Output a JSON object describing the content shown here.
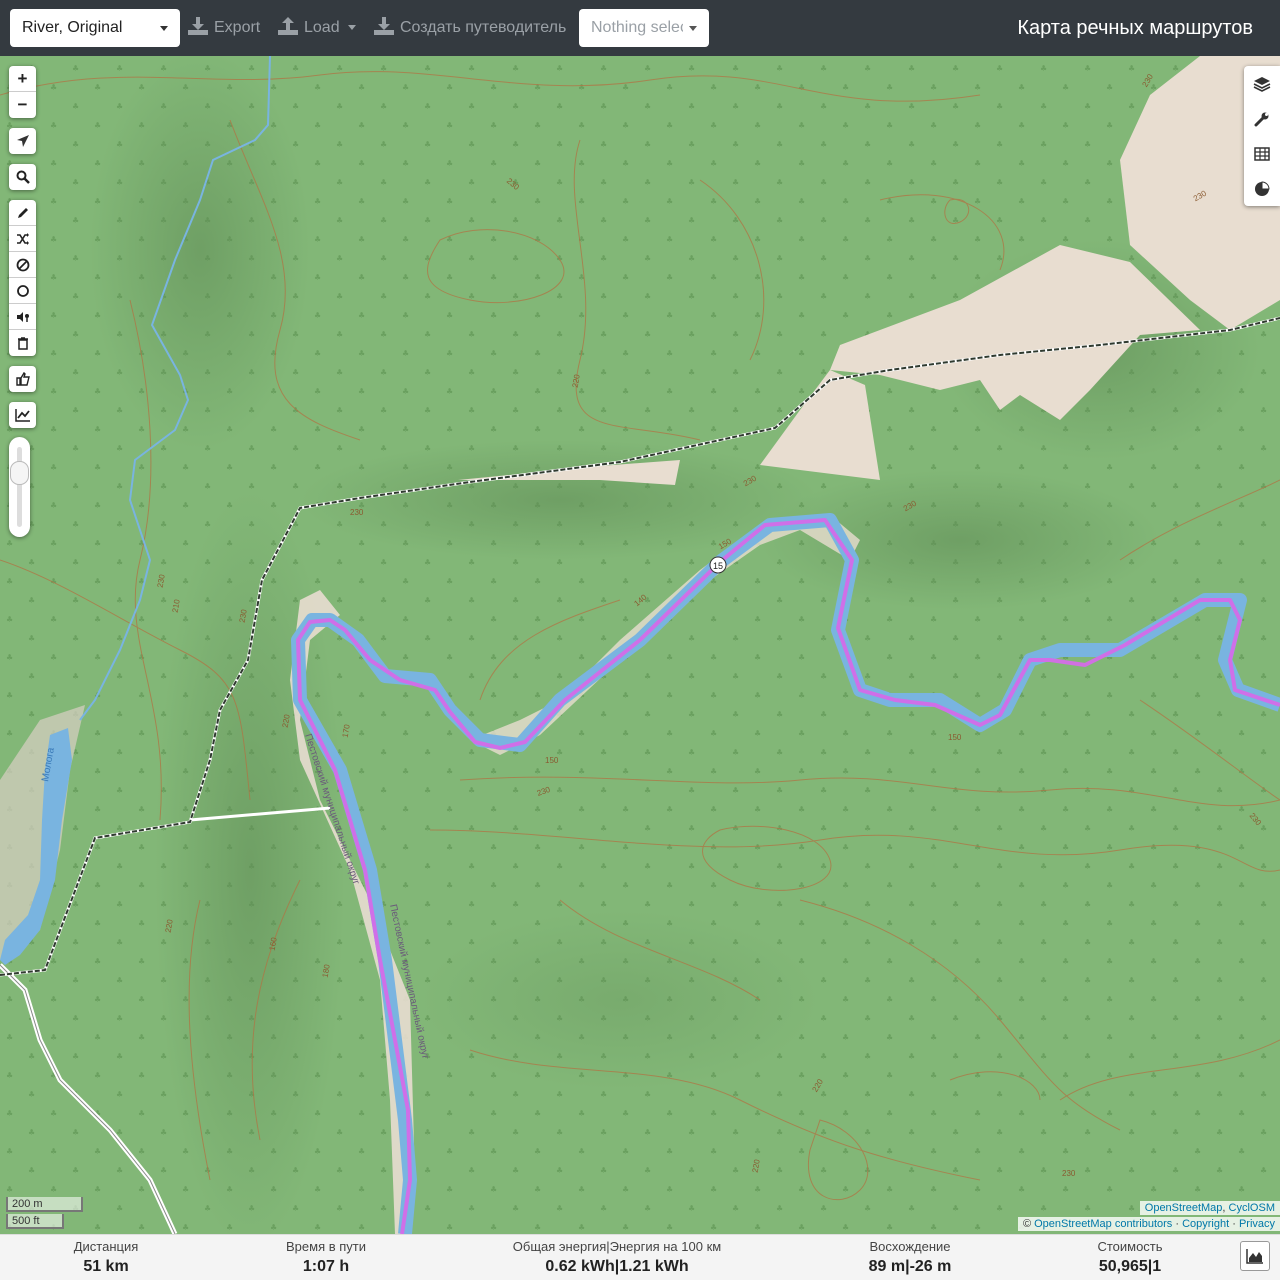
{
  "toolbar": {
    "profile_value": "River, Original",
    "export_label": "Export",
    "load_label": "Load",
    "guide_label": "Создать путеводитель",
    "nothing_selected": "Nothing selected",
    "app_title": "Карта речных маршрутов"
  },
  "map_controls": {
    "zoom_in": "+",
    "zoom_out": "−",
    "icons": [
      "locate-icon",
      "search-icon",
      "draw-pencil-icon",
      "shuffle-icon",
      "no-entry-icon",
      "circle-icon",
      "poi-icon",
      "trash-icon",
      "thumbs-up-icon",
      "elevation-chart-icon"
    ],
    "right_icons": [
      "layers-icon",
      "wrench-icon",
      "table-icon",
      "pie-chart-icon"
    ]
  },
  "map": {
    "route_marker": "15",
    "contour_labels": [
      "230",
      "220",
      "210",
      "200",
      "190",
      "180",
      "170",
      "160",
      "150",
      "140",
      "250"
    ],
    "river_label": "Молога",
    "boundary_label_1": "Пестовский муниципальный округ",
    "boundary_label_2": "Пестовский муниципальный округ",
    "colors": {
      "forest": "#7fb574",
      "route": "#d46be8",
      "river": "#79b4e0",
      "bare": "#e8ddd0",
      "track": "#2f3a2f",
      "contour": "#b07444"
    }
  },
  "scale": {
    "metric": "200 m",
    "imperial": "500 ft"
  },
  "attribution": {
    "line1_a": "OpenStreetMap",
    "line1_sep": ", ",
    "line1_b": "CyclOSM",
    "line2_prefix": "© ",
    "line2_a": "OpenStreetMap contributors",
    "line2_b": "Copyright",
    "line2_c": "Privacy",
    "dot": " · "
  },
  "stats": {
    "distance_label": "Дистанция",
    "distance_value": "51 km",
    "time_label": "Время в пути",
    "time_value": "1:07 h",
    "energy_label": "Общая энергия|Энергия на 100 км",
    "energy_value": "0.62 kWh|1.21 kWh",
    "ascent_label": "Восхождение",
    "ascent_value": "89 m|-26 m",
    "cost_label": "Стоимость",
    "cost_value": "50,965|1"
  }
}
